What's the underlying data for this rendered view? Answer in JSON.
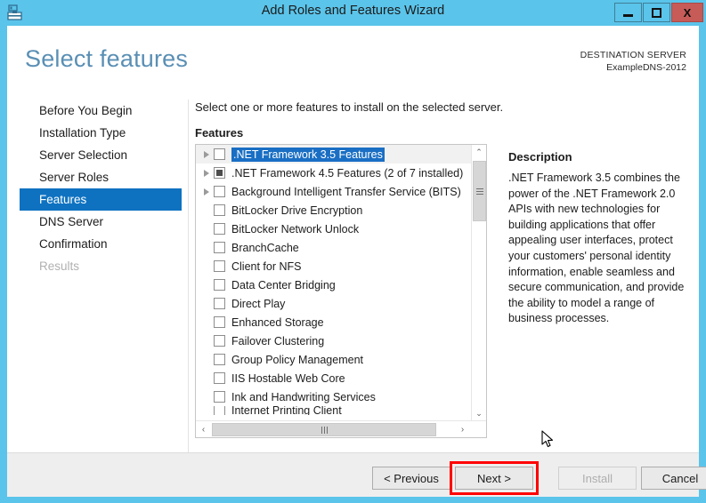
{
  "window": {
    "title": "Add Roles and Features Wizard",
    "icon": "server-wizard-icon",
    "minimize_label": "",
    "maximize_label": "",
    "close_label": "X",
    "frame_color": "#5bc4ea",
    "close_button_color": "#c75b57"
  },
  "header": {
    "page_title": "Select features",
    "destination_label": "DESTINATION SERVER",
    "destination_server": "ExampleDNS-2012",
    "title_color": "#5a8fb4"
  },
  "sidebar": {
    "selected_color": "#0e72c1",
    "items": [
      {
        "label": "Before You Begin",
        "state": "normal"
      },
      {
        "label": "Installation Type",
        "state": "normal"
      },
      {
        "label": "Server Selection",
        "state": "normal"
      },
      {
        "label": "Server Roles",
        "state": "normal"
      },
      {
        "label": "Features",
        "state": "selected"
      },
      {
        "label": "DNS Server",
        "state": "normal"
      },
      {
        "label": "Confirmation",
        "state": "normal"
      },
      {
        "label": "Results",
        "state": "disabled"
      }
    ]
  },
  "main": {
    "instruction": "Select one or more features to install on the selected server.",
    "features_label": "Features",
    "selection_color": "#1a6fc4",
    "features": [
      {
        "label": ".NET Framework 3.5 Features",
        "checkbox": "unchecked",
        "expandable": true,
        "selected": true
      },
      {
        "label": ".NET Framework 4.5 Features (2 of 7 installed)",
        "checkbox": "partial",
        "expandable": true,
        "selected": false
      },
      {
        "label": "Background Intelligent Transfer Service (BITS)",
        "checkbox": "unchecked",
        "expandable": true,
        "selected": false
      },
      {
        "label": "BitLocker Drive Encryption",
        "checkbox": "unchecked",
        "expandable": false,
        "selected": false
      },
      {
        "label": "BitLocker Network Unlock",
        "checkbox": "unchecked",
        "expandable": false,
        "selected": false
      },
      {
        "label": "BranchCache",
        "checkbox": "unchecked",
        "expandable": false,
        "selected": false
      },
      {
        "label": "Client for NFS",
        "checkbox": "unchecked",
        "expandable": false,
        "selected": false
      },
      {
        "label": "Data Center Bridging",
        "checkbox": "unchecked",
        "expandable": false,
        "selected": false
      },
      {
        "label": "Direct Play",
        "checkbox": "unchecked",
        "expandable": false,
        "selected": false
      },
      {
        "label": "Enhanced Storage",
        "checkbox": "unchecked",
        "expandable": false,
        "selected": false
      },
      {
        "label": "Failover Clustering",
        "checkbox": "unchecked",
        "expandable": false,
        "selected": false
      },
      {
        "label": "Group Policy Management",
        "checkbox": "unchecked",
        "expandable": false,
        "selected": false
      },
      {
        "label": "IIS Hostable Web Core",
        "checkbox": "unchecked",
        "expandable": false,
        "selected": false
      },
      {
        "label": "Ink and Handwriting Services",
        "checkbox": "unchecked",
        "expandable": false,
        "selected": false
      },
      {
        "label": "Internet Printing Client",
        "checkbox": "unchecked",
        "expandable": false,
        "selected": false,
        "clipped": true
      }
    ]
  },
  "description": {
    "title": "Description",
    "body": ".NET Framework 3.5 combines the power of the .NET Framework 2.0 APIs with new technologies for building applications that offer appealing user interfaces, protect your customers' personal identity information, enable seamless and secure communication, and provide the ability to model a range of business processes."
  },
  "footer": {
    "previous_label": "< Previous",
    "next_label": "Next >",
    "install_label": "Install",
    "cancel_label": "Cancel",
    "install_enabled": false,
    "highlight_color": "#ff0000",
    "highlighted_button": "Next >"
  },
  "scrollbars": {
    "vertical_up": "⌃",
    "vertical_down": "⌄",
    "horizontal_left": "‹",
    "horizontal_right": "›"
  }
}
